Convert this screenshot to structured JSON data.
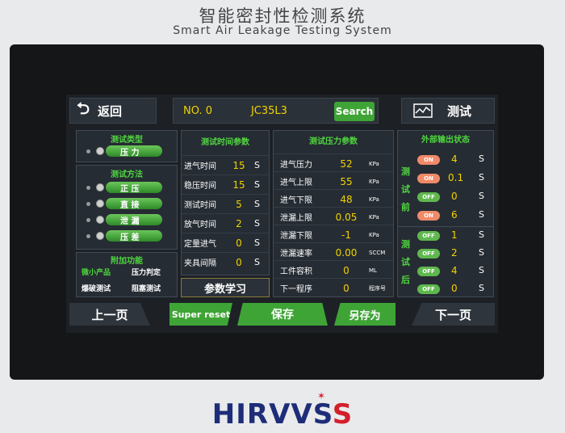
{
  "device": {
    "title_cn": "智能密封性检测系统",
    "title_en": "Smart Air Leakage Testing System",
    "brand_pre": "HIR",
    "brand_mid": "VVS",
    "brand_s": "S"
  },
  "topbar": {
    "back_label": "返回",
    "no_label": "NO. 0",
    "program_name": "JC35L3",
    "search_label": "Search",
    "test_label": "测试"
  },
  "left": {
    "test_type_header": "测试类型",
    "test_type_option": "压 力",
    "test_method_header": "测试方法",
    "methods": [
      "正 压",
      "直 接",
      "泄 漏",
      "压 差"
    ],
    "extra_header": "附加功能",
    "extras": [
      "微小产品",
      "压力判定",
      "爆破测试",
      "阻塞测试"
    ]
  },
  "time_params": {
    "header": "测试时间参数",
    "rows": [
      {
        "label": "进气时间",
        "value": "15",
        "unit": "S"
      },
      {
        "label": "稳压时间",
        "value": "15",
        "unit": "S"
      },
      {
        "label": "测试时间",
        "value": "5",
        "unit": "S"
      },
      {
        "label": "放气时间",
        "value": "2",
        "unit": "S"
      },
      {
        "label": "定量进气",
        "value": "0",
        "unit": "S"
      },
      {
        "label": "夹具间隔",
        "value": "0",
        "unit": "S"
      }
    ],
    "learn_label": "参数学习"
  },
  "pressure_params": {
    "header": "测试压力参数",
    "rows": [
      {
        "label": "进气压力",
        "value": "52",
        "unit": "KPa"
      },
      {
        "label": "进气上限",
        "value": "55",
        "unit": "KPa"
      },
      {
        "label": "进气下限",
        "value": "48",
        "unit": "KPa"
      },
      {
        "label": "泄漏上限",
        "value": "0.05",
        "unit": "KPa"
      },
      {
        "label": "泄漏下限",
        "value": "-1",
        "unit": "KPa"
      },
      {
        "label": "泄漏速率",
        "value": "0.00",
        "unit": "SCCM"
      },
      {
        "label": "工件容积",
        "value": "0",
        "unit": "ML"
      },
      {
        "label": "下一程序",
        "value": "0",
        "unit": "程序号"
      }
    ]
  },
  "outputs": {
    "header": "外部输出状态",
    "before_label": [
      "测",
      "试",
      "前"
    ],
    "after_label": [
      "测",
      "试",
      "后"
    ],
    "before": [
      {
        "state": "ON",
        "value": "4",
        "unit": "S"
      },
      {
        "state": "ON",
        "value": "0.1",
        "unit": "S"
      },
      {
        "state": "OFF",
        "value": "0",
        "unit": "S"
      },
      {
        "state": "ON",
        "value": "6",
        "unit": "S"
      }
    ],
    "after": [
      {
        "state": "OFF",
        "value": "1",
        "unit": "S"
      },
      {
        "state": "OFF",
        "value": "2",
        "unit": "S"
      },
      {
        "state": "OFF",
        "value": "4",
        "unit": "S"
      },
      {
        "state": "OFF",
        "value": "0",
        "unit": "S"
      }
    ]
  },
  "bottom": {
    "prev": "上一页",
    "super_reset": "Super reset",
    "save": "保存",
    "save_as": "另存为",
    "next": "下一页"
  },
  "colors": {
    "accent_green": "#4fd640",
    "value_yellow": "#f0d300",
    "on_orange": "#f08a68",
    "off_green": "#5fb84e"
  }
}
